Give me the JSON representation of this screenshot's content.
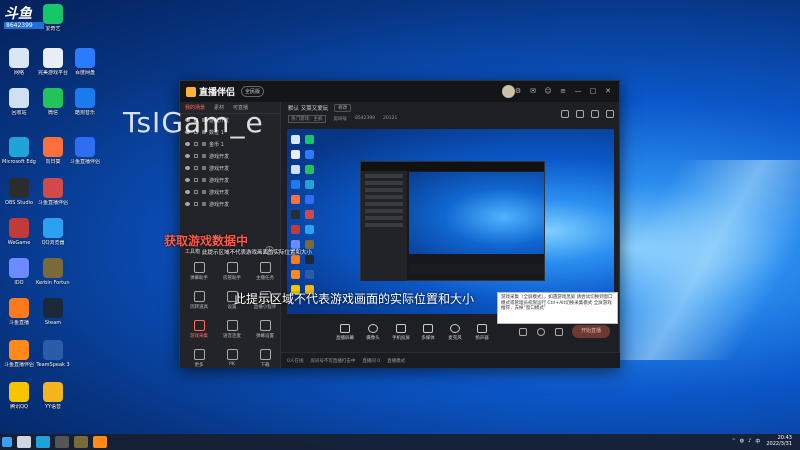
{
  "desktop": {
    "icons": [
      {
        "label": "网络",
        "color": "#d8e6f6"
      },
      {
        "label": "爱奇艺",
        "color": "#18c66a"
      },
      {
        "label": "完美游戏平台",
        "color": "#e9eef5"
      },
      {
        "label": "百度网盘",
        "color": "#2b7bff"
      },
      {
        "label": "回收站",
        "color": "#cfe0f2"
      },
      {
        "label": "微信",
        "color": "#23c35c"
      },
      {
        "label": "酷狗音乐",
        "color": "#1b7cf0"
      },
      {
        "label": "Microsoft Edge",
        "color": "#1fa3d8"
      },
      {
        "label": "向日葵",
        "color": "#ff6f3c"
      },
      {
        "label": "斗鱼直播伴侣",
        "color": "#2f6df3"
      },
      {
        "label": "OBS Studio",
        "color": "#2c2c2c"
      },
      {
        "label": "斗鱼直播伴侣",
        "color": "#d04a4a"
      },
      {
        "label": "WeGame",
        "color": "#c23a3a"
      },
      {
        "label": "QQ浏览器",
        "color": "#2ba2f0"
      },
      {
        "label": "IDO",
        "color": "#6b8cff"
      },
      {
        "label": "Kerbin Fortune",
        "color": "#7a6a3a"
      },
      {
        "label": "斗鱼直播",
        "color": "#ff7a1a"
      },
      {
        "label": "Steam",
        "color": "#1b2838"
      },
      {
        "label": "斗鱼直播伴侣",
        "color": "#ff8a1a"
      },
      {
        "label": "TeamSpeak 3",
        "color": "#2a5caa"
      },
      {
        "label": "腾讯QQ",
        "color": "#f6c400"
      },
      {
        "label": "YY语音",
        "color": "#f3b51a"
      }
    ],
    "top_left_badge": {
      "line1": "斗鱼",
      "line2": "8642399"
    }
  },
  "taskbar": {
    "items": [
      "windows-start",
      "search",
      "edge",
      "obs",
      "app",
      "douyu"
    ],
    "clock_time": "20:43",
    "clock_date": "2022/3/31"
  },
  "app": {
    "logo": "直播伴侣",
    "version": "全民版",
    "window_controls": [
      "—",
      "□",
      "✕"
    ],
    "left_tabs": [
      "我的场景",
      "素材",
      "可直播"
    ],
    "scenes": [
      "游戏开发",
      "数位 1",
      "金币 1",
      "游戏开发",
      "游戏开发",
      "游戏开发",
      "游戏开发",
      "游戏开发"
    ],
    "tools_title": "工具箱",
    "tools": [
      {
        "label": "弹幕助手",
        "active": false
      },
      {
        "label": "房管助手",
        "active": false
      },
      {
        "label": "主播任务",
        "active": false
      },
      {
        "label": "玩转道具",
        "active": false
      },
      {
        "label": "设置",
        "active": false
      },
      {
        "label": "直播小程序",
        "active": false
      },
      {
        "label": "游戏采集",
        "active": true
      },
      {
        "label": "语音连麦",
        "active": false
      },
      {
        "label": "弹幕设置",
        "active": false
      },
      {
        "label": "更多",
        "active": false
      },
      {
        "label": "PK",
        "active": false
      },
      {
        "label": "下载",
        "active": false
      }
    ],
    "room": {
      "title": "默认 又菜又爱玩",
      "edit": "修改",
      "meta": [
        "热门游戏：主机",
        "房间号",
        "8542399",
        "20121"
      ]
    },
    "preview": {
      "watermark": "TsIGam_e",
      "capture_text": "获取游戏数据中",
      "hint_small": "此提示区域不代表游戏画面的实际位置和大小",
      "hint_big": "此提示区域不代表游戏画面的实际位置和大小",
      "tooltip": "游戏采集（全屏模式），如遇游戏黑屏 请尝试切换到窗口模式或管理员权限运行 Ctrl+Alt切换采集模式 全屏游戏推荐，去掉“窗口模式”"
    },
    "controls": [
      {
        "label": "直播屏幕"
      },
      {
        "label": "摄像头"
      },
      {
        "label": "手机投屏"
      },
      {
        "label": "多媒体"
      },
      {
        "label": "麦克风"
      },
      {
        "label": "扬声器"
      }
    ],
    "live_button": "开始直播",
    "status": [
      "0人在线",
      "房间号不可直播打击中",
      "直播间 0",
      "直播模式"
    ]
  }
}
